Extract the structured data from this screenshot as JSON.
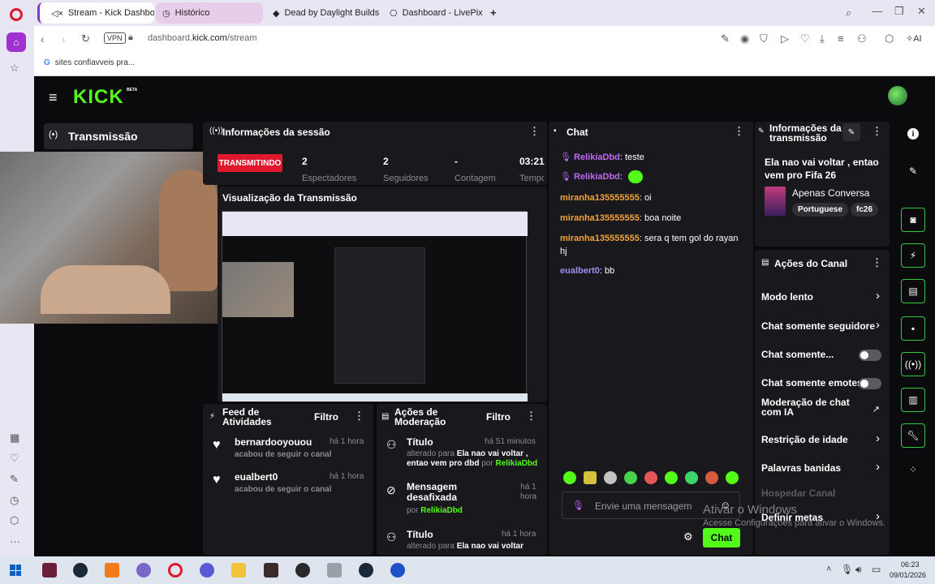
{
  "browser": {
    "tabs": [
      {
        "label": "Stream - Kick Dashbo"
      },
      {
        "label": "Histórico"
      },
      {
        "label": "Dead by Daylight Builds"
      },
      {
        "label": "Dashboard - LivePix"
      }
    ],
    "new_tab_icon": "plus-icon",
    "vpn_label": "VPN",
    "url_domain": "dashboard.",
    "url_host": "kick.com",
    "url_path": "/stream",
    "bookmark_label": "sites confiavveis pra...",
    "ai_label": "AI"
  },
  "kick": {
    "logo": "KICK",
    "logo_beta": "BETA",
    "nav_transmission": "Transmissão",
    "session": {
      "title": "Informações da sessão",
      "live_badge": "TRANSMITINDO",
      "stats": [
        {
          "value": "2",
          "label": "Espectadores"
        },
        {
          "value": "2",
          "label": "Seguidores"
        },
        {
          "value": "-",
          "label": "Contagem"
        },
        {
          "value": "03:21",
          "label": "Tempo"
        }
      ]
    },
    "preview_title": "Visualização da Transmissão",
    "chat": {
      "title": "Chat",
      "messages": [
        {
          "user": "RelikiaDbd",
          "text": ": teste",
          "color": "#bb6bf2"
        },
        {
          "user": "RelikiaDbd",
          "text": ":",
          "color": "#bb6bf2"
        },
        {
          "user": "miranha135555555",
          "text": ": oi",
          "color": "#f2a33a"
        },
        {
          "user": "miranha135555555",
          "text": ": boa noite",
          "color": "#f2a33a"
        },
        {
          "user": "miranha135555555",
          "text": ": sera q tem gol do rayan hj",
          "color": "#f2a33a"
        },
        {
          "user": "eualbert0",
          "text": ": bb",
          "color": "#a38cf2"
        }
      ],
      "input_placeholder": "Envie uma mensagem",
      "send_label": "Chat"
    },
    "stream_info": {
      "title": "Informações da transmissão",
      "stream_title": "Ela nao vai voltar , entao vem pro Fifa 26",
      "category": "Apenas Conversa",
      "tags": [
        "Portuguese",
        "fc26"
      ]
    },
    "channel_actions": {
      "title": "Ações do Canal",
      "items": [
        {
          "label": "Modo lento",
          "type": "chevron"
        },
        {
          "label": "Chat somente seguidore",
          "type": "chevron"
        },
        {
          "label": "Chat somente...",
          "type": "toggle"
        },
        {
          "label": "Chat somente emotes",
          "type": "toggle"
        },
        {
          "label": "Moderação de chat com IA",
          "type": "external"
        },
        {
          "label": "Restrição de idade",
          "type": "chevron"
        },
        {
          "label": "Palavras banidas",
          "type": "chevron"
        },
        {
          "label": "Hospedar Canal",
          "type": "disabled"
        },
        {
          "label": "Definir metas",
          "type": "chevron"
        }
      ]
    },
    "activity_feed": {
      "title": "Feed de Atividades",
      "filter": "Filtro",
      "items": [
        {
          "user": "bernardooyouou",
          "time": "há 1 hora",
          "desc": "acabou de seguir o canal"
        },
        {
          "user": "eualbert0",
          "time": "há 1 hora",
          "desc": "acabou de seguir o canal"
        }
      ]
    },
    "mod_actions": {
      "title": "Ações de Moderação",
      "filter": "Filtro",
      "items": [
        {
          "title": "Título",
          "time": "há 51 minutos",
          "prefix": "alterado para",
          "value": "Ela nao vai voltar , entao vem pro dbd",
          "by": "por",
          "mod": "RelikiaDbd"
        },
        {
          "title": "Mensagem desafixada",
          "time": "há 1 hora",
          "prefix": "",
          "value": "",
          "by": "por",
          "mod": "RelikiaDbd"
        },
        {
          "title": "Título",
          "time": "há 1 hora",
          "prefix": "alterado para",
          "value": "Ela nao vai voltar",
          "by": "",
          "mod": ""
        }
      ]
    },
    "watermark_title": "Ativar o Windows",
    "watermark_sub": "Acesse Configurações para ativar o Windows."
  },
  "taskbar": {
    "time": "06:23",
    "date": "09/01/2026"
  },
  "colors": {
    "kick_green": "#53fc18",
    "live_red": "#e0182d",
    "panel_bg": "#19191d"
  }
}
